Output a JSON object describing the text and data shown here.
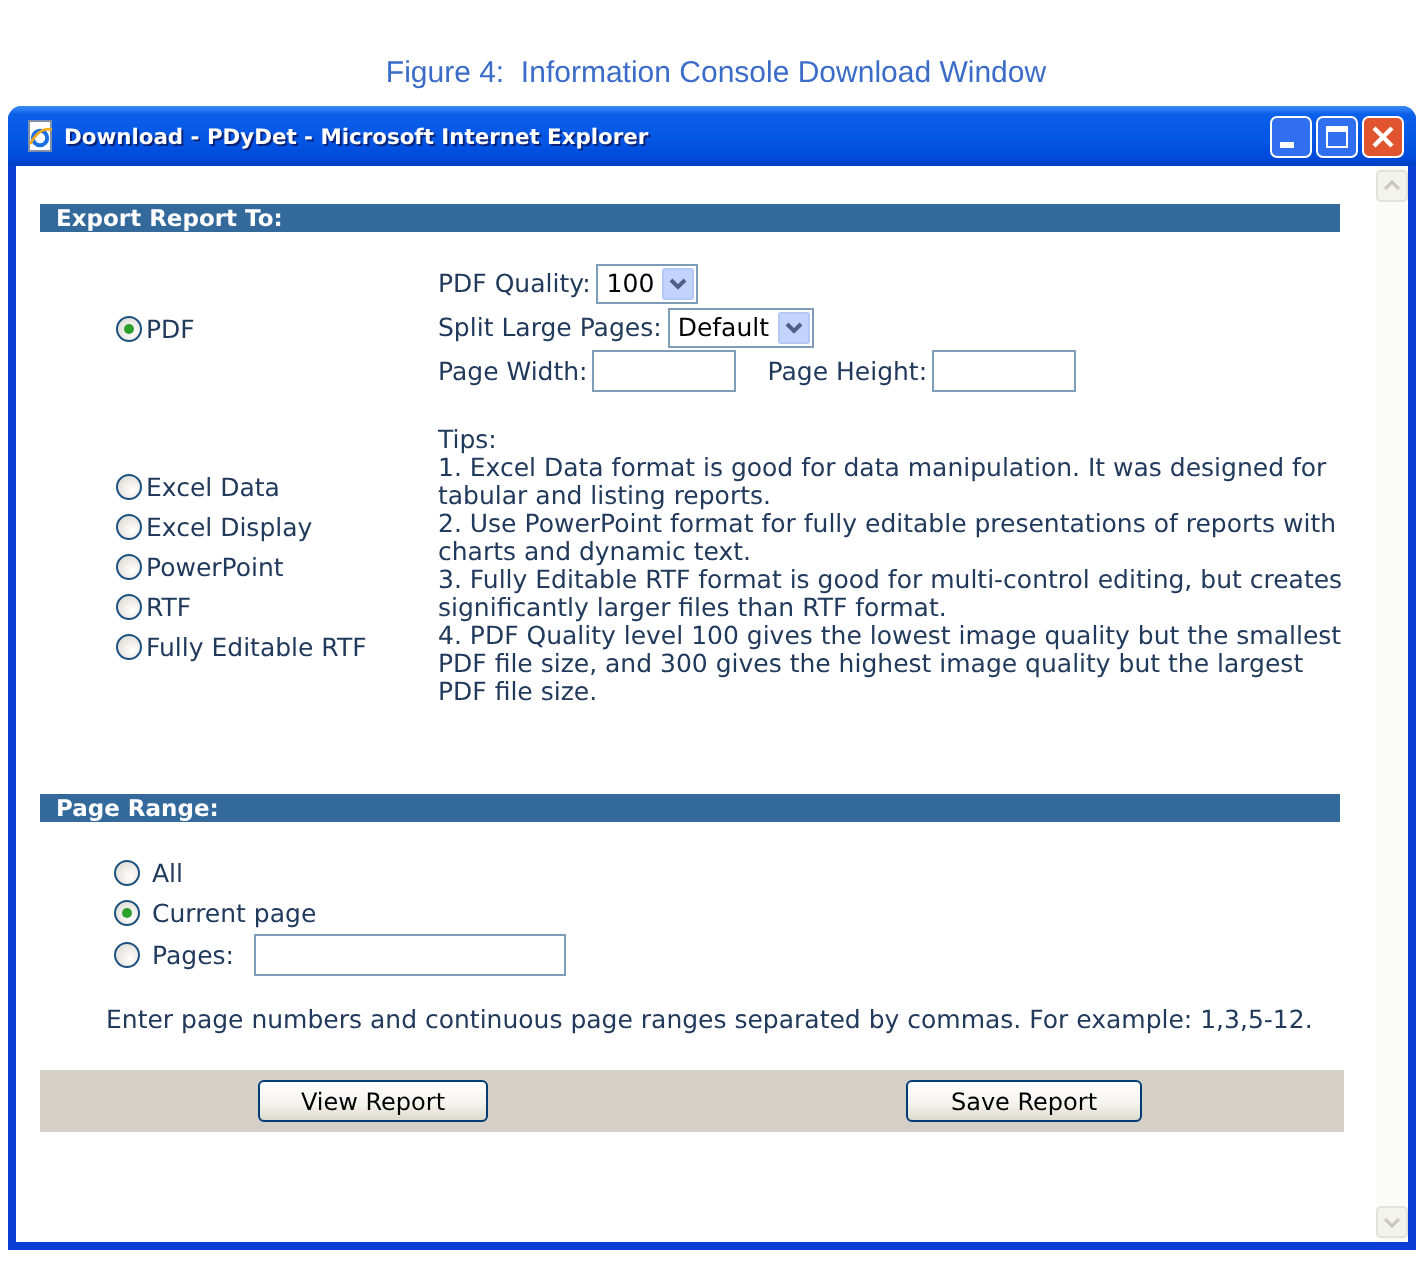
{
  "caption": "Figure 4:  Information Console Download Window",
  "window": {
    "title": "Download - PDyDet - Microsoft Internet Explorer"
  },
  "export_section": {
    "heading": "Export Report To:",
    "formats": [
      {
        "label": "PDF",
        "selected": true
      },
      {
        "label": "Excel Data",
        "selected": false
      },
      {
        "label": "Excel Display",
        "selected": false
      },
      {
        "label": "PowerPoint",
        "selected": false
      },
      {
        "label": "RTF",
        "selected": false
      },
      {
        "label": "Fully Editable RTF",
        "selected": false
      }
    ],
    "pdf_options": [
      {
        "kind": "select",
        "label": "PDF Quality:",
        "value": "100"
      },
      {
        "kind": "select",
        "label": "Split Large Pages:",
        "value": "Default"
      },
      {
        "kind": "fields",
        "fields": [
          {
            "label": "Page Width:"
          },
          {
            "label": "Page Height:"
          }
        ]
      }
    ],
    "tips": {
      "heading": "Tips:",
      "items": [
        "1. Excel Data format is good for data manipulation. It was designed for tabular and listing reports.",
        "2. Use PowerPoint format for fully editable presentations of reports with charts and dynamic text.",
        "3. Fully Editable RTF format is good for multi-control editing, but creates significantly larger files than RTF format.",
        "4. PDF Quality level 100 gives the lowest image quality but the smallest PDF file size, and 300 gives the highest image quality but the largest PDF file size."
      ]
    }
  },
  "page_range_section": {
    "heading": "Page Range:",
    "options": [
      {
        "kind": "plain",
        "label": "All",
        "selected": false
      },
      {
        "kind": "plain",
        "label": "Current page",
        "selected": true
      },
      {
        "kind": "field",
        "label": "Pages:",
        "selected": false
      }
    ],
    "note": "Enter page numbers and continuous page ranges separated by commas. For example: 1,3,5-12."
  },
  "buttons": [
    "View Report",
    "Save Report"
  ]
}
